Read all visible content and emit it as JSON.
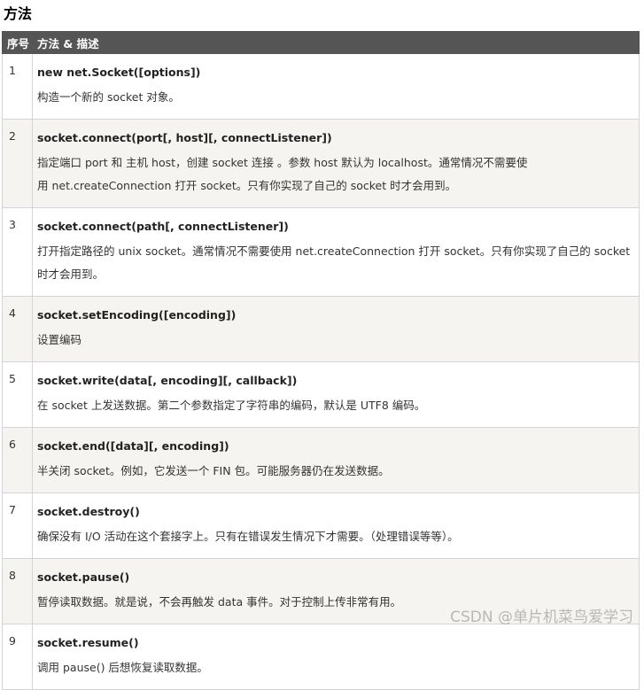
{
  "title": "方法",
  "table": {
    "headers": [
      "序号",
      "方法 & 描述"
    ],
    "rows": [
      {
        "num": "1",
        "sig": "new net.Socket([options])",
        "desc": "构造一个新的 socket 对象。"
      },
      {
        "num": "2",
        "sig": "socket.connect(port[, host][, connectListener])",
        "desc": "指定端口 port 和 主机 host，创建 socket 连接 。参数 host 默认为 localhost。通常情况不需要使用 net.createConnection 打开 socket。只有你实现了自己的 socket 时才会用到。"
      },
      {
        "num": "3",
        "sig": "socket.connect(path[, connectListener])",
        "desc": "打开指定路径的 unix socket。通常情况不需要使用 net.createConnection 打开 socket。只有你实现了自己的 socket 时才会用到。"
      },
      {
        "num": "4",
        "sig": "socket.setEncoding([encoding])",
        "desc": "设置编码"
      },
      {
        "num": "5",
        "sig": "socket.write(data[, encoding][, callback])",
        "desc": "在 socket 上发送数据。第二个参数指定了字符串的编码，默认是 UTF8 编码。"
      },
      {
        "num": "6",
        "sig": "socket.end([data][, encoding])",
        "desc": "半关闭 socket。例如，它发送一个 FIN 包。可能服务器仍在发送数据。"
      },
      {
        "num": "7",
        "sig": "socket.destroy()",
        "desc": "确保没有 I/O 活动在这个套接字上。只有在错误发生情况下才需要。（处理错误等等）。"
      },
      {
        "num": "8",
        "sig": "socket.pause()",
        "desc": "暂停读取数据。就是说，不会再触发 data 事件。对于控制上传非常有用。"
      },
      {
        "num": "9",
        "sig": "socket.resume()",
        "desc": "调用 pause() 后想恢复读取数据。"
      }
    ]
  },
  "watermark": "CSDN @单片机菜鸟爱学习"
}
